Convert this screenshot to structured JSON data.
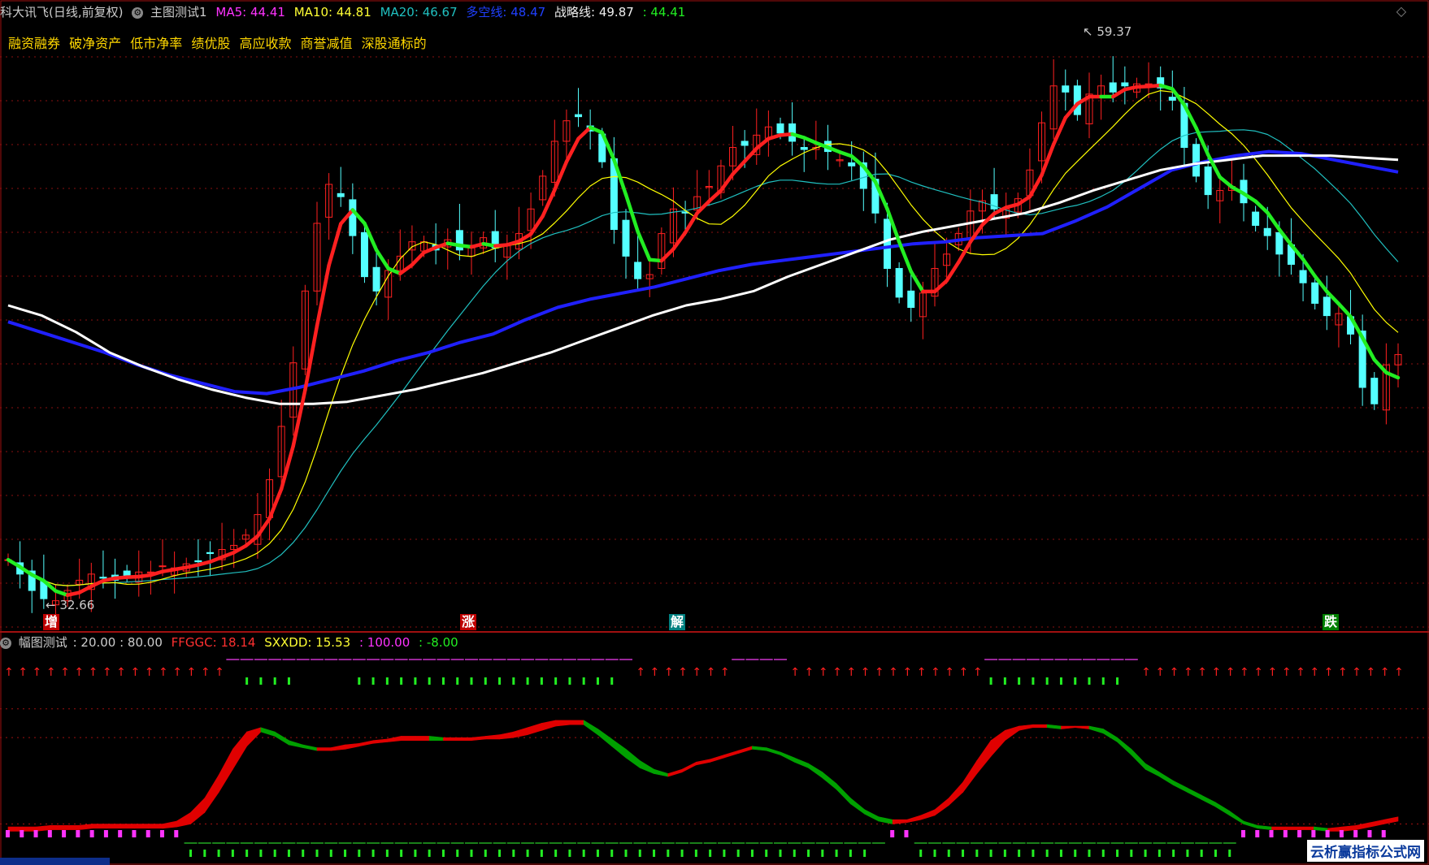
{
  "header": {
    "title": "科大讯飞(日线,前复权)",
    "chart_name": "主图测试1",
    "ma5_label": "MA5:",
    "ma5_value": "44.41",
    "ma10_label": "MA10:",
    "ma10_value": "44.81",
    "ma20_label": "MA20:",
    "ma20_value": "46.67",
    "dkx_label": "多空线:",
    "dkx_value": "48.47",
    "strat_label": "战略线:",
    "strat_value": "49.87",
    "last_value": ": 44.41"
  },
  "tags": [
    "融资融券",
    "破净资产",
    "低市净率",
    "绩优股",
    "高应收款",
    "商誉减值",
    "深股通标的"
  ],
  "price_labels": {
    "max": "59.37",
    "min": "32.66"
  },
  "signals": [
    {
      "label": "增",
      "color": "#c00000"
    },
    {
      "label": "涨",
      "color": "#c00000"
    },
    {
      "label": "解",
      "color": "#008080"
    },
    {
      "label": "跌",
      "color": "#008000"
    }
  ],
  "sub_header": {
    "name": "幅图测试",
    "params": ": 20.00 : 80.00",
    "ffggc_label": "FFGGC:",
    "ffggc_value": "18.14",
    "sxxdd_label": "SXXDD:",
    "sxxdd_value": "15.53",
    "v100": ": 100.00",
    "vneg": ": -8.00"
  },
  "watermark": "云析赢指标公式网",
  "colors": {
    "up": "#ff2020",
    "down": "#54ffff",
    "ma5": "#ffffff",
    "ma10": "#ffff00",
    "ma20": "#20c0c0",
    "dkx_up": "#ff2020",
    "dkx_down": "#22ee22",
    "strategy": "#2020ff",
    "long": "#ffffff",
    "grid": "#8a1010"
  },
  "chart_data": {
    "type": "line",
    "close": [
      34.9,
      34.2,
      33.4,
      33.0,
      32.9,
      33.4,
      33.9,
      34.2,
      34.0,
      33.9,
      34.1,
      34.3,
      34.3,
      34.6,
      34.5,
      34.7,
      34.8,
      35.2,
      35.4,
      35.6,
      36.1,
      37.1,
      38.8,
      41.4,
      44.5,
      48.0,
      51.3,
      53.2,
      52.6,
      50.7,
      48.7,
      48.0,
      49.0,
      49.7,
      50.4,
      50.4,
      50.0,
      50.5,
      50.0,
      50.1,
      50.6,
      50.1,
      50.2,
      50.8,
      52.0,
      53.6,
      55.3,
      56.3,
      56.5,
      55.8,
      54.3,
      51.0,
      49.7,
      48.6,
      48.8,
      50.8,
      52.0,
      51.8,
      52.6,
      53.1,
      54.1,
      55.0,
      55.1,
      55.6,
      56.0,
      55.7,
      55.3,
      54.9,
      55.0,
      54.8,
      54.4,
      54.1,
      53.0,
      51.8,
      49.1,
      47.7,
      47.2,
      47.9,
      49.1,
      49.8,
      50.8,
      51.9,
      52.4,
      52.0,
      52.0,
      52.5,
      53.9,
      56.2,
      58.0,
      57.7,
      56.6,
      57.6,
      58.0,
      57.7,
      58.0,
      58.1,
      58.1,
      57.9,
      57.3,
      55.0,
      53.6,
      52.7,
      52.9,
      53.1,
      52.3,
      51.2,
      50.7,
      49.8,
      49.3,
      48.4,
      47.4,
      46.8,
      46.9,
      45.9,
      43.3,
      42.5,
      44.4,
      44.9
    ],
    "ma_long": [
      47.3,
      46.8,
      46.0,
      45.0,
      44.3,
      43.7,
      43.2,
      42.8,
      42.5,
      42.5,
      42.6,
      42.9,
      43.2,
      43.6,
      44.0,
      44.5,
      45.0,
      45.6,
      46.2,
      46.8,
      47.3,
      47.6,
      48.0,
      48.7,
      49.3,
      49.9,
      50.5,
      50.9,
      51.2,
      51.5,
      51.8,
      52.3,
      52.9,
      53.4,
      53.9,
      54.2,
      54.4,
      54.6,
      54.6,
      54.6,
      54.5,
      54.4
    ],
    "ma_long_label": "",
    "strategy": [
      46.5,
      46.0,
      45.5,
      45.0,
      44.4,
      43.9,
      43.5,
      43.1,
      43.0,
      43.3,
      43.7,
      44.1,
      44.6,
      45.0,
      45.5,
      45.9,
      46.6,
      47.2,
      47.6,
      47.9,
      48.2,
      48.6,
      49.0,
      49.3,
      49.5,
      49.7,
      49.9,
      50.1,
      50.3,
      50.4,
      50.6,
      50.7,
      50.8,
      51.4,
      52.1,
      53.0,
      53.9,
      54.3,
      54.6,
      54.8,
      54.7,
      54.4,
      54.1,
      53.8
    ],
    "ylim": [
      31.5,
      61.0
    ],
    "indicator": {
      "type": "area",
      "upper": [
        18,
        18,
        18,
        19,
        19,
        19,
        20,
        20,
        20,
        20,
        20,
        20,
        22,
        28,
        38,
        54,
        72,
        84,
        87,
        84,
        78,
        75,
        73,
        73,
        75,
        76,
        78,
        79,
        81,
        81,
        81,
        80,
        80,
        80,
        81,
        82,
        84,
        87,
        90,
        92,
        92,
        92,
        86,
        79,
        72,
        64,
        58,
        55,
        58,
        63,
        65,
        68,
        71,
        74,
        73,
        70,
        66,
        62,
        56,
        48,
        38,
        30,
        25,
        23,
        23,
        26,
        30,
        38,
        49,
        64,
        78,
        85,
        88,
        89,
        89,
        88,
        88,
        88,
        86,
        80,
        72,
        62,
        56,
        50,
        45,
        40,
        35,
        29,
        22,
        19,
        18,
        18,
        18,
        18,
        17,
        18,
        19,
        21,
        23,
        25
      ],
      "lower": [
        15,
        15,
        15,
        16,
        16,
        16,
        17,
        17,
        17,
        17,
        17,
        17,
        18,
        20,
        28,
        42,
        58,
        74,
        84,
        81,
        75,
        73,
        71,
        71,
        72,
        74,
        76,
        77,
        78,
        78,
        78,
        78,
        78,
        78,
        79,
        79,
        80,
        82,
        85,
        88,
        89,
        89,
        82,
        74,
        66,
        59,
        55,
        53,
        56,
        61,
        63,
        66,
        69,
        72,
        71,
        68,
        63,
        59,
        52,
        44,
        34,
        27,
        22,
        20,
        21,
        23,
        26,
        33,
        42,
        55,
        67,
        78,
        85,
        87,
        87,
        86,
        87,
        86,
        83,
        77,
        68,
        58,
        53,
        47,
        42,
        37,
        32,
        26,
        20,
        17,
        16,
        16,
        16,
        16,
        15,
        15,
        16,
        18,
        20,
        22
      ],
      "levels": [
        100,
        80,
        20
      ]
    }
  }
}
